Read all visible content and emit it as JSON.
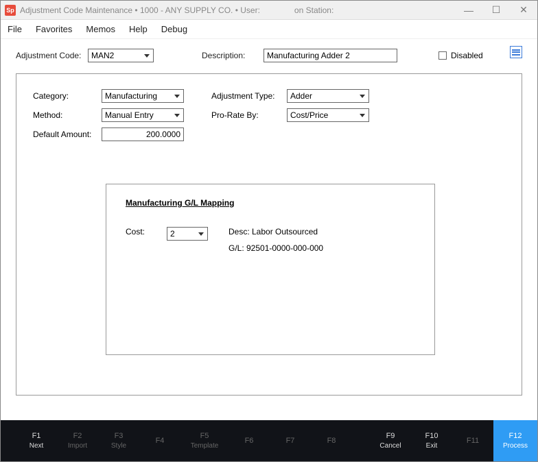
{
  "titlebar": {
    "app_icon_text": "Sp",
    "title": "Adjustment Code Maintenance   •   1000 - ANY SUPPLY CO.   •   User: ",
    "title_station": "on Station:"
  },
  "menu": {
    "file": "File",
    "favorites": "Favorites",
    "memos": "Memos",
    "help": "Help",
    "debug": "Debug"
  },
  "row1": {
    "adj_code_label": "Adjustment Code:",
    "adj_code_value": "MAN2",
    "description_label": "Description:",
    "description_value": "Manufacturing Adder 2",
    "disabled_label": "Disabled"
  },
  "form": {
    "category_label": "Category:",
    "category_value": "Manufacturing",
    "method_label": "Method:",
    "method_value": "Manual Entry",
    "default_amount_label": "Default Amount:",
    "default_amount_value": "200.0000",
    "adj_type_label": "Adjustment Type:",
    "adj_type_value": "Adder",
    "pro_rate_label": "Pro-Rate By:",
    "pro_rate_value": "Cost/Price"
  },
  "inner": {
    "title": "Manufacturing G/L Mapping",
    "cost_label": "Cost:",
    "cost_value": "2",
    "desc_line": "Desc: Labor Outsourced",
    "gl_line": "G/L: 92501-0000-000-000"
  },
  "footer": {
    "f1": {
      "key": "F1",
      "label": "Next"
    },
    "f2": {
      "key": "F2",
      "label": "Import"
    },
    "f3": {
      "key": "F3",
      "label": "Style"
    },
    "f4": {
      "key": "F4",
      "label": ""
    },
    "f5": {
      "key": "F5",
      "label": "Template"
    },
    "f6": {
      "key": "F6",
      "label": ""
    },
    "f7": {
      "key": "F7",
      "label": ""
    },
    "f8": {
      "key": "F8",
      "label": ""
    },
    "f9": {
      "key": "F9",
      "label": "Cancel"
    },
    "f10": {
      "key": "F10",
      "label": "Exit"
    },
    "f11": {
      "key": "F11",
      "label": ""
    },
    "f12": {
      "key": "F12",
      "label": "Process"
    }
  }
}
